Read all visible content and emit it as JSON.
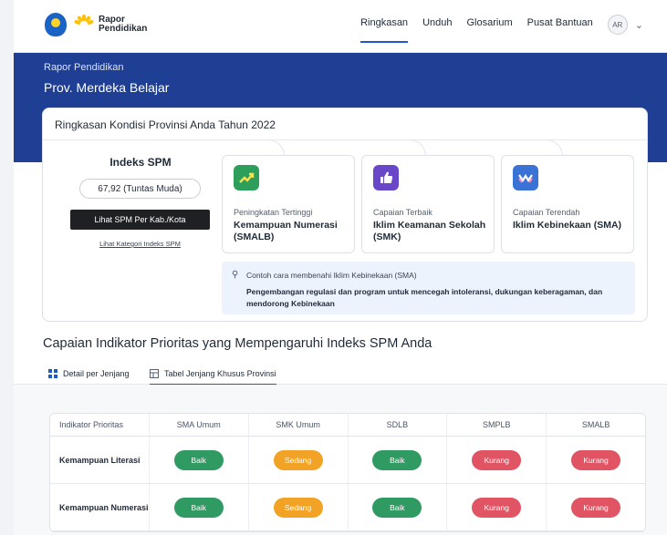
{
  "nav": {
    "logo_line1": "Rapor",
    "logo_line2": "Pendidikan",
    "links": [
      "Ringkasan",
      "Unduh",
      "Glosarium",
      "Pusat Bantuan"
    ],
    "active_link": "Ringkasan",
    "avatar_initials": "AR"
  },
  "hero": {
    "subtitle": "Rapor Pendidikan",
    "title": "Prov. Merdeka Belajar"
  },
  "summary": {
    "title": "Ringkasan Kondisi Provinsi Anda Tahun 2022",
    "index_title": "Indeks SPM",
    "index_value": "67,92 (Tuntas Muda)",
    "index_button": "Lihat SPM Per Kab./Kota",
    "index_link": "Lihat Kategori Indeks SPM",
    "stats": [
      {
        "label": "Peningkatan Tertinggi",
        "value": "Kemampuan Numerasi (SMALB)",
        "icon": "chart-up-icon",
        "color": "#2e9e5b"
      },
      {
        "label": "Capaian Terbaik",
        "value": "Iklim Keamanan Sekolah (SMK)",
        "icon": "thumbs-up-icon",
        "color": "#6a46c9"
      },
      {
        "label": "Capaian Terendah",
        "value": "Iklim Kebinekaan (SMA)",
        "icon": "wave-icon",
        "color": "#3a72d6"
      }
    ],
    "tip_head": "Contoh cara membenahi Iklim Kebinekaan (SMA)",
    "tip_body": "Pengembangan regulasi dan program untuk mencegah intoleransi, dukungan keberagaman, dan mendorong Kebinekaan"
  },
  "section": {
    "title": "Capaian Indikator Prioritas yang Mempengaruhi Indeks SPM Anda",
    "tabs": [
      "Detail per Jenjang",
      "Tabel Jenjang Khusus Provinsi"
    ],
    "active_tab": "Tabel Jenjang Khusus Provinsi"
  },
  "table": {
    "headers": [
      "Indikator Prioritas",
      "SMA Umum",
      "SMK Umum",
      "SDLB",
      "SMPLB",
      "SMALB"
    ],
    "rows": [
      {
        "indicator": "Kemampuan Literasi",
        "values": [
          "Baik",
          "Sedang",
          "Baik",
          "Kurang",
          "Kurang"
        ]
      },
      {
        "indicator": "Kemampuan Numerasi",
        "values": [
          "Baik",
          "Sedang",
          "Baik",
          "Kurang",
          "Kurang"
        ]
      }
    ]
  },
  "status_colors": {
    "Baik": "#2f9b63",
    "Sedang": "#f2a325",
    "Kurang": "#e05463"
  }
}
